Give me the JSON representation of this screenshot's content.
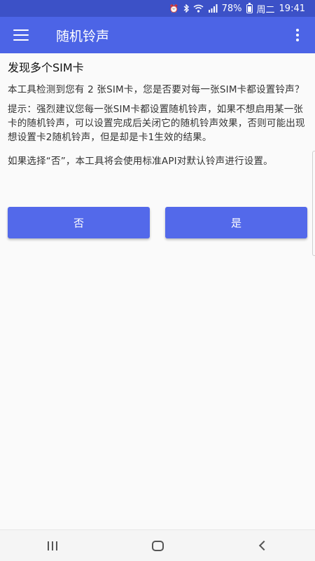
{
  "status_bar": {
    "battery_percent": "78%",
    "date": "周二",
    "time": "19:41",
    "icons": [
      "alarm-icon",
      "bluetooth-icon",
      "wifi-icon",
      "signal-icon",
      "battery-icon"
    ]
  },
  "app_bar": {
    "title": "随机铃声",
    "menu_icon": "hamburger-icon",
    "overflow_icon": "more-vert-icon",
    "background_color": "#4c64e6"
  },
  "dialog": {
    "title": "发现多个SIM卡",
    "message": "本工具检测到您有 2 张SIM卡，您是否要对每一张SIM卡都设置铃声？",
    "tip": "提示：强烈建议您每一张SIM卡都设置随机铃声，如果不想启用某一张卡的随机铃声，可以设置完成后关闭它的随机铃声效果，否则可能出现想设置卡2随机铃声，但是却是卡1生效的结果。",
    "note": "如果选择“否”，本工具将会使用标准API对默认铃声进行设置。",
    "no_label": "否",
    "yes_label": "是",
    "button_color": "#5369ea"
  },
  "nav_bar": {
    "icons": [
      "recent-apps-icon",
      "home-icon",
      "back-icon"
    ]
  }
}
